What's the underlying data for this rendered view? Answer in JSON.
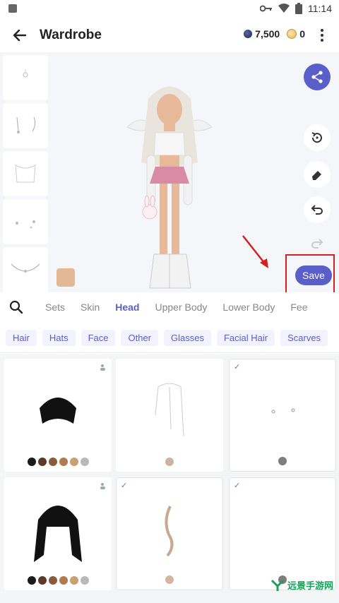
{
  "status_bar": {
    "time": "11:14"
  },
  "app_bar": {
    "title": "Wardrobe",
    "gems": "7,500",
    "coins": "0"
  },
  "preview": {
    "save_label": "Save",
    "skin_color": "#e4b894",
    "accent": "#5a5ec9",
    "highlight_color": "#d42020"
  },
  "categories": [
    "Sets",
    "Skin",
    "Head",
    "Upper Body",
    "Lower Body",
    "Fee"
  ],
  "active_category": "Head",
  "subcategories": [
    "Hair",
    "Hats",
    "Face",
    "Other",
    "Glasses",
    "Facial Hair",
    "Scarves"
  ],
  "items": [
    {
      "icon": "black-short-hair",
      "selected": false,
      "user_badge": true,
      "colors": [
        "#1a1a1a",
        "#5b3a2a",
        "#8a5a3a",
        "#b07a52",
        "#c9a070",
        "#b9b9b9"
      ]
    },
    {
      "icon": "white-long-hair",
      "selected": false,
      "user_badge": false,
      "colors": [
        "#cdb2a2"
      ]
    },
    {
      "icon": "face-dots",
      "selected": true,
      "user_badge": false,
      "colors": [
        "#7d7d7d"
      ]
    },
    {
      "icon": "black-long-hair",
      "selected": false,
      "user_badge": true,
      "colors": [
        "#1a1a1a",
        "#5b3a2a",
        "#8a5a3a",
        "#b07a52",
        "#c9a070",
        "#b9b9b9"
      ]
    },
    {
      "icon": "hair-strand",
      "selected": true,
      "user_badge": false,
      "colors": [
        "#d2b4a0"
      ]
    },
    {
      "icon": "empty-item",
      "selected": true,
      "user_badge": false,
      "colors": [
        "#7d7d7d"
      ]
    }
  ],
  "watermark": "远景手游网"
}
